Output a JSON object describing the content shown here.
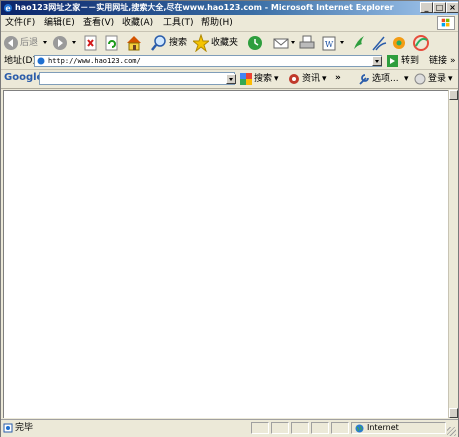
{
  "window": {
    "title": "hao123网址之家－－实用网址,搜索大全,尽在www.hao123.com - Microsoft Internet Explorer",
    "controls": {
      "minimize": "_",
      "maximize": "□",
      "close": "×"
    }
  },
  "menubar": {
    "items": [
      "文件(F)",
      "编辑(E)",
      "查看(V)",
      "收藏(A)",
      "工具(T)",
      "帮助(H)"
    ]
  },
  "toolbar": {
    "back_label": "后退",
    "search_label": "搜索",
    "favorites_label": "收藏夹"
  },
  "addressbar": {
    "label": "地址(D)",
    "url": "http://www.hao123.com/",
    "go_label": "转到",
    "links_label": "链接"
  },
  "googlebar": {
    "logo": "Google",
    "search_value": "",
    "search_button": "搜索",
    "news_label": "资讯",
    "more": "»",
    "options_label": "选项...",
    "login_label": "登录"
  },
  "statusbar": {
    "status_text": "完毕",
    "zone_text": "Internet"
  },
  "colors": {
    "titlebar_start": "#0a246a",
    "titlebar_end": "#a6caf0",
    "chrome": "#ece9d8",
    "content": "#ffffff"
  }
}
